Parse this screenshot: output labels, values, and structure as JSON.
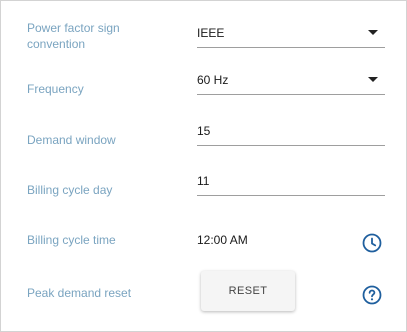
{
  "settings": {
    "power_factor": {
      "label": "Power factor sign convention",
      "value": "IEEE"
    },
    "frequency": {
      "label": "Frequency",
      "value": "60 Hz"
    },
    "demand_window": {
      "label": "Demand window",
      "value": "15"
    },
    "billing_cycle_day": {
      "label": "Billing cycle day",
      "value": "11"
    },
    "billing_cycle_time": {
      "label": "Billing cycle time",
      "value": "12:00 AM",
      "icon": "clock-icon"
    },
    "peak_demand_reset": {
      "label": "Peak demand reset",
      "button_label": "RESET",
      "icon": "help-circle-icon"
    }
  },
  "colors": {
    "label": "#7aa4c0",
    "value": "#1a1a1a",
    "accent_icon": "#1f5f9e",
    "underline": "#9e9e9e"
  }
}
